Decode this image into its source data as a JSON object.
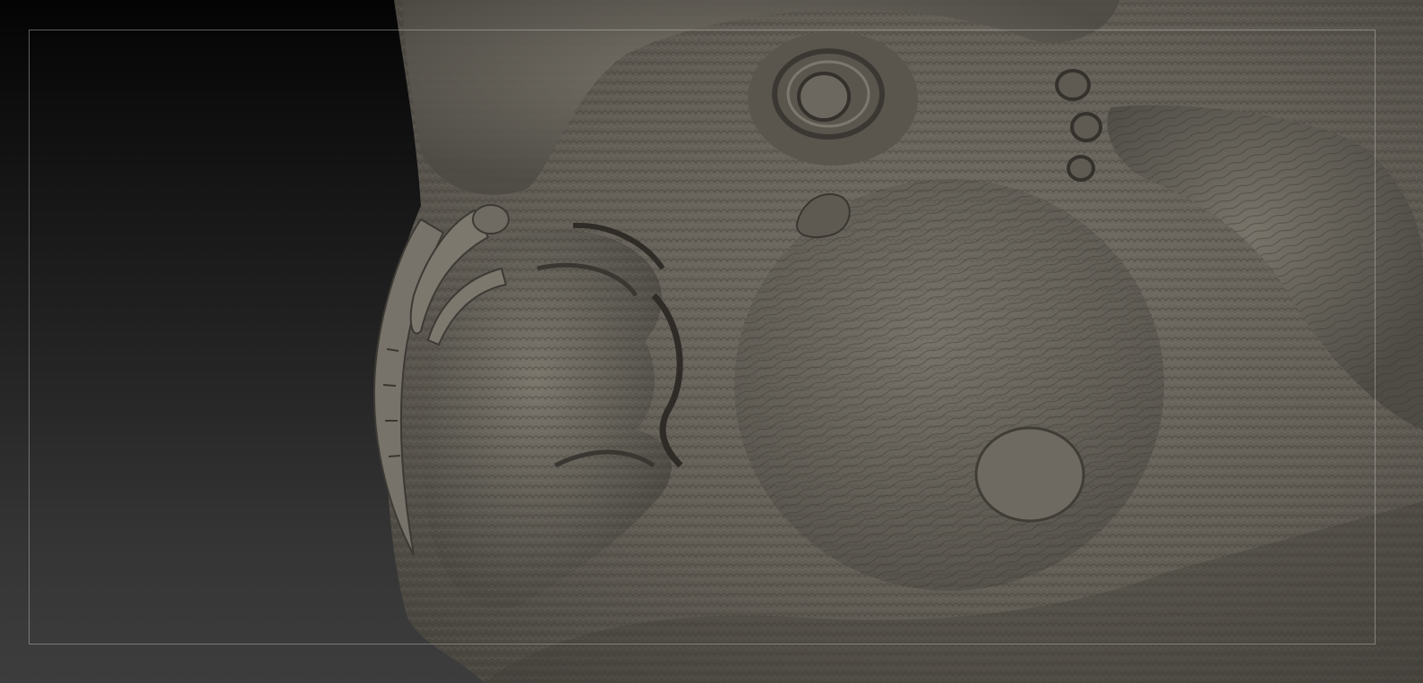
{
  "viewport": {
    "background_top": "#040404",
    "background_bottom": "#3d3d3d",
    "frame_color": "#c8c8c8"
  },
  "model": {
    "material_color": "#68645c",
    "highlight_color": "#8a857b",
    "shadow_color": "#3a3732"
  }
}
